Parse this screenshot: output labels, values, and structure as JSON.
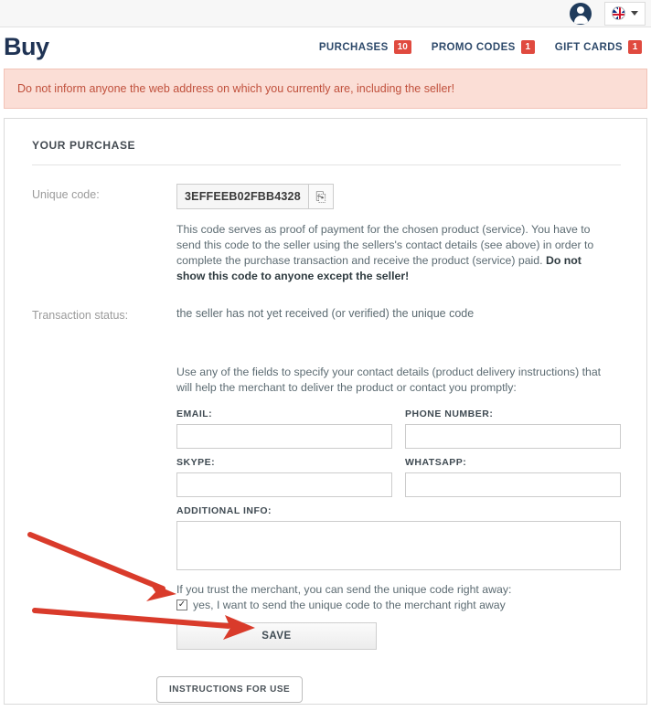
{
  "topbar": {
    "avatar_icon": "user-avatar-icon",
    "language_flag": "uk-flag-icon",
    "language_chevron": "chevron-down-icon"
  },
  "header": {
    "brand": "Buy",
    "nav": [
      {
        "label": "PURCHASES",
        "badge": "10"
      },
      {
        "label": "PROMO CODES",
        "badge": "1"
      },
      {
        "label": "GIFT CARDS",
        "badge": "1"
      }
    ]
  },
  "alert": {
    "text": "Do not inform anyone the web address on which you currently are, including the seller!",
    "bg_color": "#fbded6",
    "border_color": "#f2c3b7",
    "text_color": "#c0503c"
  },
  "card": {
    "title": "YOUR PURCHASE",
    "unique_code": {
      "label": "Unique code:",
      "value": "3EFFEEB02FBB4328",
      "copy_icon": "clipboard-copy-icon",
      "copy_glyph": "⎘",
      "description_part1": "This code serves as proof of payment for the chosen product (service). You have to send this code to the seller using the sellers's contact details (see above) in order to complete the purchase transaction and receive the product (service) paid. ",
      "description_bold": "Do not show this code to anyone except the seller!"
    },
    "transaction_status": {
      "label": "Transaction status:",
      "value": "the seller has not yet received (or verified) the unique code"
    },
    "contact_hint": "Use any of the fields to specify your contact details (product delivery instructions) that will help the merchant to deliver the product or contact you promptly:",
    "fields": {
      "email": {
        "label": "EMAIL:",
        "value": "",
        "placeholder": ""
      },
      "phone": {
        "label": "PHONE NUMBER:",
        "value": "",
        "placeholder": ""
      },
      "skype": {
        "label": "SKYPE:",
        "value": "",
        "placeholder": ""
      },
      "whatsapp": {
        "label": "WHATSAPP:",
        "value": "",
        "placeholder": ""
      },
      "additional": {
        "label": "ADDITIONAL INFO:",
        "value": "",
        "placeholder": ""
      }
    },
    "trust": {
      "line": "If you trust the merchant, you can send the unique code right away:",
      "checkbox_label": "yes, I want to send the unique code to the merchant right away",
      "checkbox_checked": true,
      "check_glyph": "✓"
    },
    "save_label": "SAVE",
    "instructions_label": "INSTRUCTIONS FOR USE"
  },
  "annotations": {
    "arrow_color": "#d93b2b",
    "arrow_1_target": "send-code-checkbox",
    "arrow_2_target": "save-button"
  }
}
